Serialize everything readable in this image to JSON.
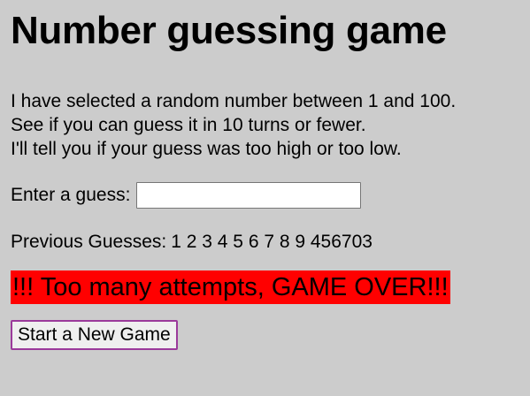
{
  "page": {
    "title": "Number guessing game"
  },
  "intro": {
    "line1": "I have selected a random number between 1 and 100.",
    "line2": "See if you can guess it in 10 turns or fewer.",
    "line3": "I'll tell you if your guess was too high or too low."
  },
  "guess_form": {
    "label": "Enter a guess:",
    "value": "",
    "placeholder": ""
  },
  "previous_guesses": {
    "label": "Previous Guesses:",
    "values": "1 2 3 4 5 6 7 8 9 456703"
  },
  "status": {
    "message": "!!! Too many attempts, GAME OVER!!!",
    "background_color": "#ff0000"
  },
  "new_game": {
    "label": "Start a New Game"
  },
  "colors": {
    "page_background": "#cccccc",
    "status_background": "#ff0000",
    "button_border": "#9b3a9b"
  }
}
